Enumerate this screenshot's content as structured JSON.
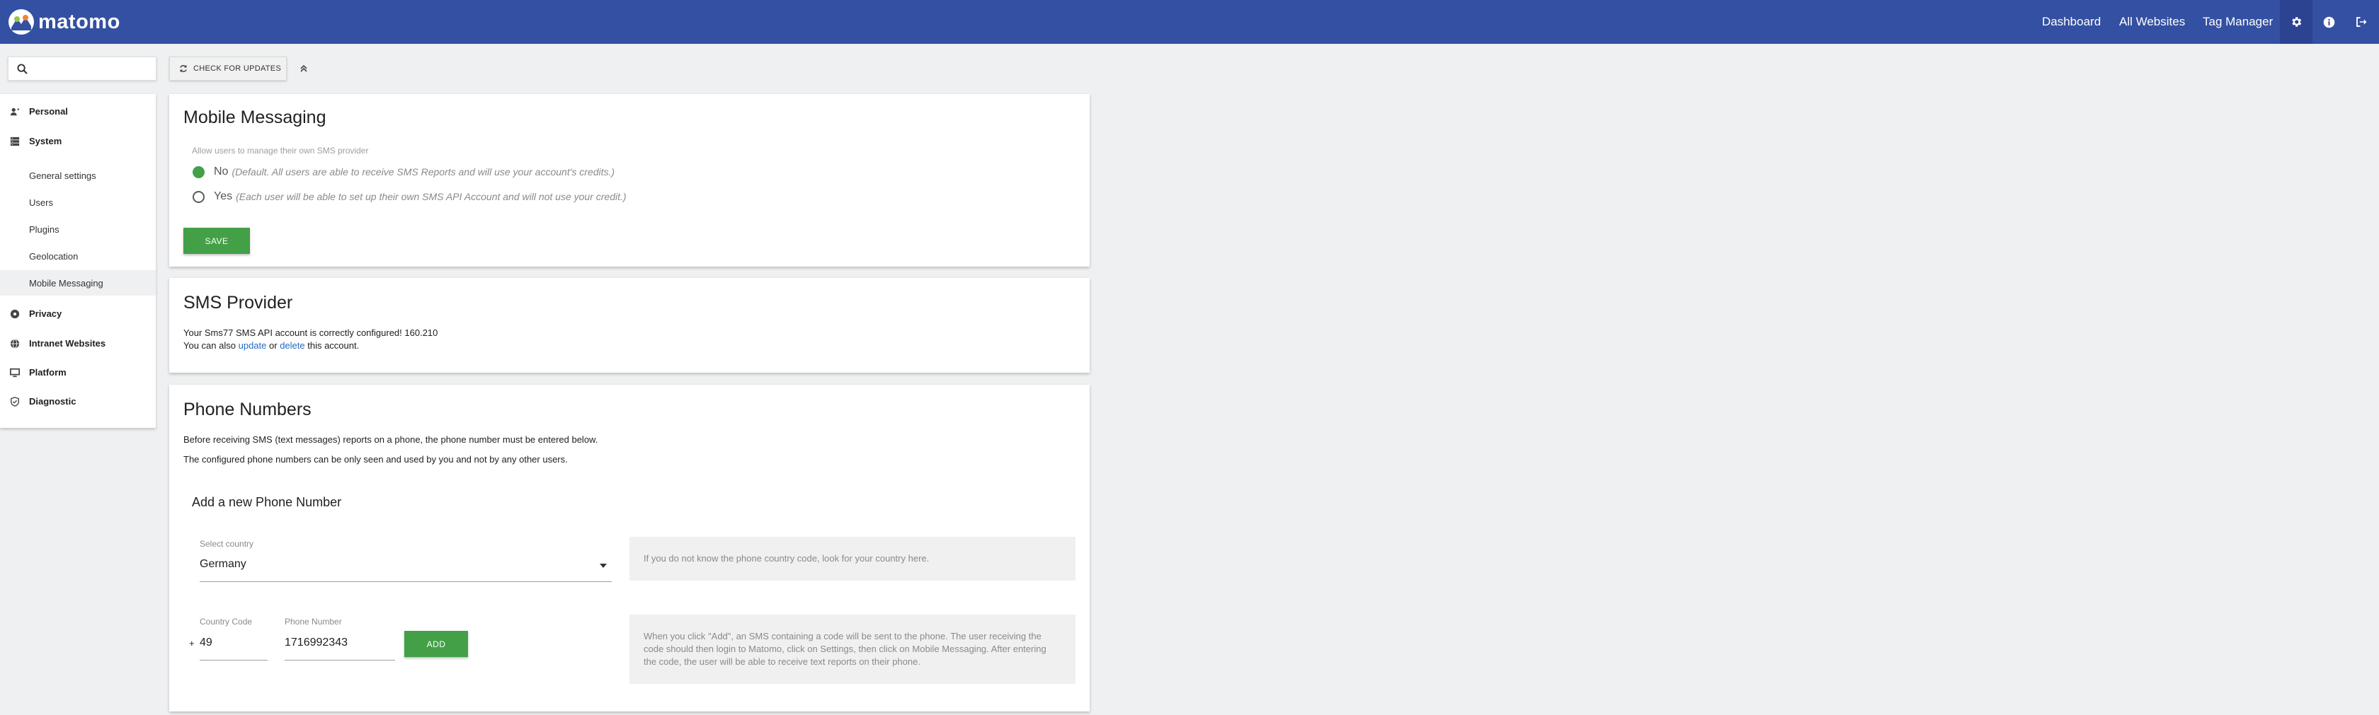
{
  "topbar": {
    "logo_text": "matomo",
    "nav": [
      "Dashboard",
      "All Websites",
      "Tag Manager"
    ],
    "icons": [
      "gear-icon",
      "info-icon",
      "logout-icon"
    ],
    "color": "#3450a3"
  },
  "search": {
    "value": "",
    "icon": "search-icon"
  },
  "sidebar": {
    "personal": "Personal",
    "system": "System",
    "system_items": [
      "General settings",
      "Users",
      "Plugins",
      "Geolocation",
      "Mobile Messaging"
    ],
    "privacy": "Privacy",
    "intranet": "Intranet Websites",
    "platform": "Platform",
    "diagnostic": "Diagnostic"
  },
  "toolbar": {
    "check_updates": "CHECK FOR UPDATES"
  },
  "mobile_messaging": {
    "title": "Mobile Messaging",
    "setting_label": "Allow users to manage their own SMS provider",
    "option_no": "No",
    "option_no_desc": "(Default. All users are able to receive SMS Reports and will use your account's credits.)",
    "option_yes": "Yes",
    "option_yes_desc": "(Each user will be able to set up their own SMS API Account and will not use your credit.)",
    "selected": "No",
    "save": "SAVE"
  },
  "sms_provider": {
    "title": "SMS Provider",
    "status": "Your Sms77 SMS API account is correctly configured! 160.210",
    "also_prefix": "You can also",
    "update_link": "update",
    "or": "or",
    "delete_link": "delete",
    "suffix": "this account."
  },
  "phone_numbers": {
    "title": "Phone Numbers",
    "intro1": "Before receiving SMS (text messages) reports on a phone, the phone number must be entered below.",
    "intro2": "The configured phone numbers can be only seen and used by you and not by any other users.",
    "add_title": "Add a new Phone Number",
    "country_label": "Select country",
    "country_value": "Germany",
    "country_help": "If you do not know the phone country code, look for your country here.",
    "code_label": "Country Code",
    "code_prefix": "+",
    "code_value": "49",
    "number_label": "Phone Number",
    "number_value": "1716992343",
    "add_button": "ADD",
    "add_help": "When you click \"Add\", an SMS containing a code will be sent to the phone. The user receiving the code should then login to Matomo, click on Settings, then click on Mobile Messaging. After entering the code, the user will be able to receive text reports on their phone."
  },
  "colors": {
    "accent_green": "#43a047",
    "link": "#1e6cc7"
  }
}
